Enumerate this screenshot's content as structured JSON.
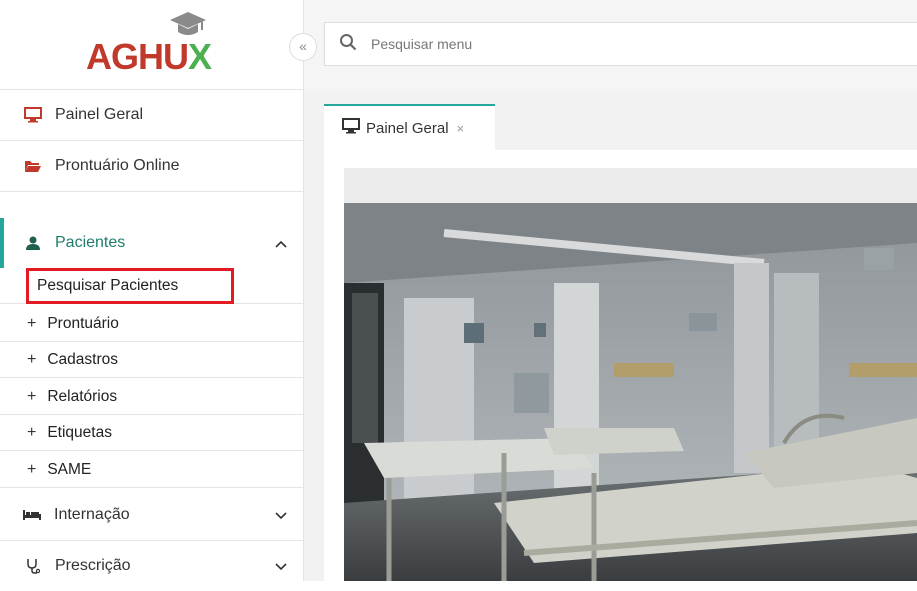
{
  "logo": {
    "part_a": "A",
    "part_ghu": "GHU",
    "part_x": "X"
  },
  "collapse": {
    "glyph": "«"
  },
  "search": {
    "placeholder": "Pesquisar menu"
  },
  "sidebar": {
    "items": [
      {
        "label": "Painel Geral",
        "icon": "monitor-icon"
      },
      {
        "label": "Prontuário Online",
        "icon": "folder-open-icon"
      },
      {
        "label": "Pacientes",
        "icon": "user-icon",
        "expanded": true,
        "chevron": "^"
      },
      {
        "label": "Internação",
        "icon": "bed-icon",
        "chevron": "v"
      },
      {
        "label": "Prescrição",
        "icon": "stethoscope-icon",
        "chevron": "v"
      }
    ],
    "pacientes_submenu": [
      {
        "label": "Pesquisar Pacientes"
      },
      {
        "label": "Prontuário",
        "prefix": "+"
      },
      {
        "label": "Cadastros",
        "prefix": "+"
      },
      {
        "label": "Relatórios",
        "prefix": "+"
      },
      {
        "label": "Etiquetas",
        "prefix": "+"
      },
      {
        "label": "SAME",
        "prefix": "+"
      }
    ]
  },
  "tabs": [
    {
      "label": "Painel Geral",
      "close": "×"
    }
  ],
  "colors": {
    "accent": "#26a69a",
    "highlight": "#e21b23",
    "logo_red": "#c0392b",
    "logo_green": "#4caf50"
  }
}
